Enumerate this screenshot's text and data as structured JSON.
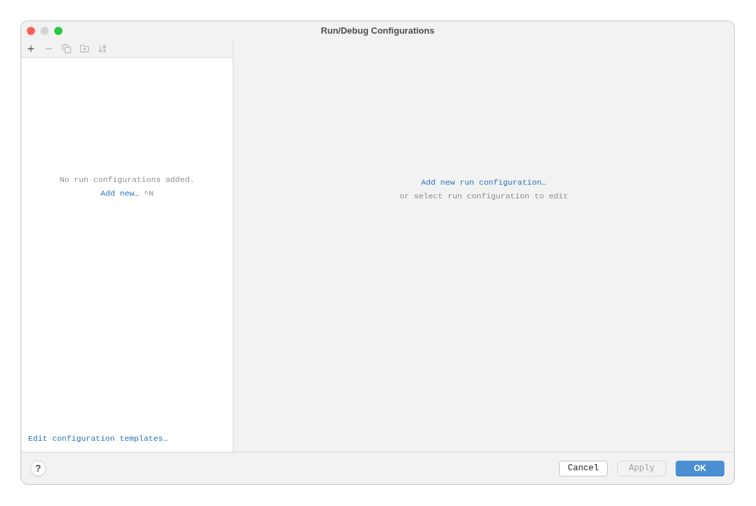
{
  "window": {
    "title": "Run/Debug Configurations"
  },
  "toolbar": [
    {
      "kind": "add",
      "disabled": false
    },
    {
      "kind": "remove",
      "disabled": true
    },
    {
      "kind": "copy",
      "disabled": true
    },
    {
      "kind": "folder",
      "disabled": true
    },
    {
      "kind": "sort",
      "disabled": true
    }
  ],
  "sidebar": {
    "empty_message": "No run configurations added.",
    "add_link": "Add new…",
    "add_shortcut": "^N",
    "templates_link": "Edit configuration templates…"
  },
  "main": {
    "add_link": "Add new run configuration…",
    "hint": "or select run configuration to edit"
  },
  "footer": {
    "help": "?",
    "buttons": [
      {
        "kind": "secondary",
        "label": "Cancel",
        "disabled": false
      },
      {
        "kind": "secondary",
        "label": "Apply",
        "disabled": true
      },
      {
        "kind": "primary",
        "label": "OK",
        "disabled": false
      }
    ]
  }
}
